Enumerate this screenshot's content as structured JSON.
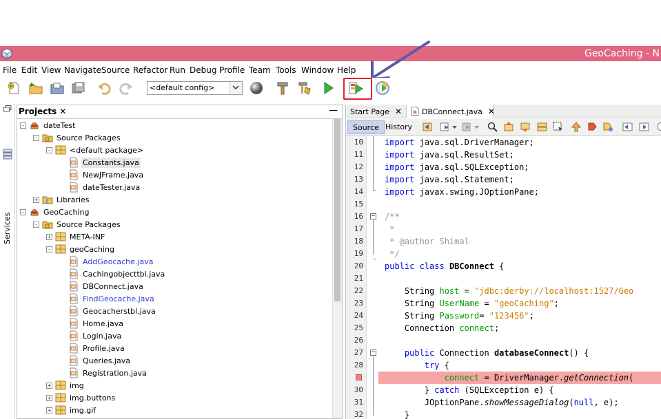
{
  "window": {
    "title": "GeoCaching - N"
  },
  "menu": [
    "File",
    "Edit",
    "View",
    "Navigate",
    "Source",
    "Refactor",
    "Run",
    "Debug",
    "Profile",
    "Team",
    "Tools",
    "Window",
    "Help"
  ],
  "toolbar": {
    "config_value": "<default config>"
  },
  "sidebar": {
    "services_label": "Services"
  },
  "projects": {
    "tab_label": "Projects",
    "close_glyph": "✕",
    "minimize_glyph": "—",
    "tree": [
      {
        "label": "dateTest",
        "indent": 0,
        "icon": "project-icon",
        "exp": "-"
      },
      {
        "label": "Source Packages",
        "indent": 1,
        "icon": "source-packages-icon",
        "exp": "-"
      },
      {
        "label": "<default package>",
        "indent": 2,
        "icon": "package-icon",
        "exp": "-"
      },
      {
        "label": "Constants.java",
        "indent": 3,
        "icon": "java-file-icon",
        "selected": true
      },
      {
        "label": "NewJFrame.java",
        "indent": 3,
        "icon": "java-file-icon"
      },
      {
        "label": "dateTester.java",
        "indent": 3,
        "icon": "java-file-icon"
      },
      {
        "label": "Libraries",
        "indent": 1,
        "icon": "libraries-icon",
        "exp": "+"
      },
      {
        "label": "GeoCaching",
        "indent": 0,
        "icon": "project-icon",
        "exp": "-"
      },
      {
        "label": "Source Packages",
        "indent": 1,
        "icon": "source-packages-icon",
        "exp": "-"
      },
      {
        "label": "META-INF",
        "indent": 2,
        "icon": "package-icon",
        "exp": "+"
      },
      {
        "label": "geoCaching",
        "indent": 2,
        "icon": "package-icon",
        "exp": "-"
      },
      {
        "label": "AddGeocache.java",
        "indent": 3,
        "icon": "java-file-icon",
        "modified": true
      },
      {
        "label": "Cachingobjecttbl.java",
        "indent": 3,
        "icon": "java-file-icon"
      },
      {
        "label": "DBConnect.java",
        "indent": 3,
        "icon": "java-file-icon"
      },
      {
        "label": "FindGeocache.java",
        "indent": 3,
        "icon": "java-file-icon",
        "modified": true
      },
      {
        "label": "Geocacherstbl.java",
        "indent": 3,
        "icon": "java-file-icon"
      },
      {
        "label": "Home.java",
        "indent": 3,
        "icon": "java-file-icon"
      },
      {
        "label": "Login.java",
        "indent": 3,
        "icon": "java-file-icon"
      },
      {
        "label": "Profile.java",
        "indent": 3,
        "icon": "java-file-icon"
      },
      {
        "label": "Queries.java",
        "indent": 3,
        "icon": "java-file-icon"
      },
      {
        "label": "Registration.java",
        "indent": 3,
        "icon": "java-file-icon"
      },
      {
        "label": "img",
        "indent": 2,
        "icon": "package-icon",
        "exp": "+"
      },
      {
        "label": "img.buttons",
        "indent": 2,
        "icon": "package-icon",
        "exp": "+"
      },
      {
        "label": "img.gif",
        "indent": 2,
        "icon": "package-icon",
        "exp": "+"
      }
    ]
  },
  "editor": {
    "tabs": [
      {
        "label": "Start Page",
        "active": false
      },
      {
        "label": "DBConnect.java",
        "active": true
      }
    ],
    "close_glyph": "✕",
    "source_label": "Source",
    "history_label": "History",
    "code": [
      {
        "n": "10",
        "parts": [
          [
            "kw",
            "import"
          ],
          [
            "",
            "java.sql.DriverManager;"
          ]
        ]
      },
      {
        "n": "11",
        "parts": [
          [
            "kw",
            "import"
          ],
          [
            "",
            "java.sql.ResultSet;"
          ]
        ]
      },
      {
        "n": "12",
        "parts": [
          [
            "kw",
            "import"
          ],
          [
            "",
            "java.sql.SQLException;"
          ]
        ]
      },
      {
        "n": "13",
        "parts": [
          [
            "kw",
            "import"
          ],
          [
            "",
            "java.sql.Statement;"
          ]
        ]
      },
      {
        "n": "14",
        "parts": [
          [
            "kw",
            "import"
          ],
          [
            "",
            "javax.swing.JOptionPane;"
          ]
        ]
      },
      {
        "n": "15",
        "parts": []
      },
      {
        "n": "16",
        "parts": [
          [
            "cmt",
            "/**"
          ]
        ]
      },
      {
        "n": "17",
        "parts": [
          [
            "cmt",
            " *"
          ]
        ]
      },
      {
        "n": "18",
        "parts": [
          [
            "cmt",
            " * @author Shimal"
          ]
        ]
      },
      {
        "n": "19",
        "parts": [
          [
            "cmt",
            " */"
          ]
        ]
      },
      {
        "n": "20",
        "parts": [
          [
            "kw",
            "public class"
          ],
          [
            "",
            " "
          ],
          [
            "bold",
            "DBConnect"
          ],
          [
            "",
            " {"
          ]
        ]
      },
      {
        "n": "21",
        "parts": []
      },
      {
        "n": "22",
        "parts": [
          [
            "",
            "    String "
          ],
          [
            "fld",
            "host"
          ],
          [
            "",
            " = "
          ],
          [
            "str",
            "\"jdbc:derby://localhost:1527/Geo"
          ]
        ]
      },
      {
        "n": "23",
        "parts": [
          [
            "",
            "    String "
          ],
          [
            "fld",
            "UserName"
          ],
          [
            "",
            " = "
          ],
          [
            "str",
            "\"geoCaching\""
          ],
          [
            "",
            ";"
          ]
        ]
      },
      {
        "n": "24",
        "parts": [
          [
            "",
            "    String "
          ],
          [
            "fld",
            "Password"
          ],
          [
            "",
            "= "
          ],
          [
            "str",
            "\"123456\""
          ],
          [
            "",
            ";"
          ]
        ]
      },
      {
        "n": "25",
        "parts": [
          [
            "",
            "    Connection "
          ],
          [
            "fld",
            "connect"
          ],
          [
            "",
            ";"
          ]
        ]
      },
      {
        "n": "26",
        "parts": []
      },
      {
        "n": "27",
        "parts": [
          [
            "kw",
            "    public"
          ],
          [
            "",
            " Connection "
          ],
          [
            "bold",
            "databaseConnect"
          ],
          [
            "",
            "() {"
          ]
        ]
      },
      {
        "n": "28",
        "parts": [
          [
            "kw",
            "        try"
          ],
          [
            "",
            " {"
          ]
        ]
      },
      {
        "n": "",
        "parts": [
          [
            "",
            "            "
          ],
          [
            "fld",
            "connect"
          ],
          [
            "",
            " = DriverManager."
          ],
          [
            "ital",
            "getConnection"
          ],
          [
            "",
            "("
          ]
        ]
      },
      {
        "n": "30",
        "parts": [
          [
            "",
            "        } "
          ],
          [
            "kw",
            "catch"
          ],
          [
            "",
            " (SQLException e) {"
          ]
        ]
      },
      {
        "n": "31",
        "parts": [
          [
            "",
            "        JOptionPane."
          ],
          [
            "ital",
            "showMessageDialog"
          ],
          [
            "",
            "("
          ],
          [
            "kw",
            "null"
          ],
          [
            "",
            ", e);"
          ]
        ]
      },
      {
        "n": "32",
        "parts": [
          [
            "",
            "    }"
          ]
        ]
      }
    ]
  }
}
